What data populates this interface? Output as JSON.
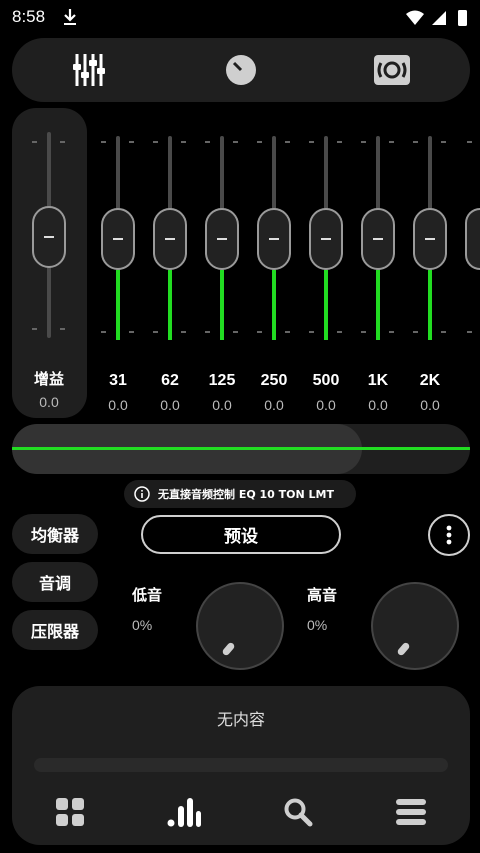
{
  "status": {
    "time": "8:58"
  },
  "gain": {
    "label": "增益",
    "value": "0.0"
  },
  "bands": [
    {
      "freq": "31",
      "value": "0.0"
    },
    {
      "freq": "62",
      "value": "0.0"
    },
    {
      "freq": "125",
      "value": "0.0"
    },
    {
      "freq": "250",
      "value": "0.0"
    },
    {
      "freq": "500",
      "value": "0.0"
    },
    {
      "freq": "1K",
      "value": "0.0"
    },
    {
      "freq": "2K",
      "value": "0.0"
    }
  ],
  "notice": {
    "text": "无直接音频控制 EQ 10 TON LMT"
  },
  "tabs": {
    "equalizer": "均衡器",
    "tone": "音调",
    "limiter": "压限器"
  },
  "preset": {
    "label": "预设"
  },
  "bass": {
    "label": "低音",
    "value": "0%"
  },
  "treble": {
    "label": "高音",
    "value": "0%"
  },
  "player": {
    "empty": "无内容"
  },
  "colors": {
    "accent": "#22dd22",
    "panel": "#1f1f1f",
    "background": "#000000"
  }
}
